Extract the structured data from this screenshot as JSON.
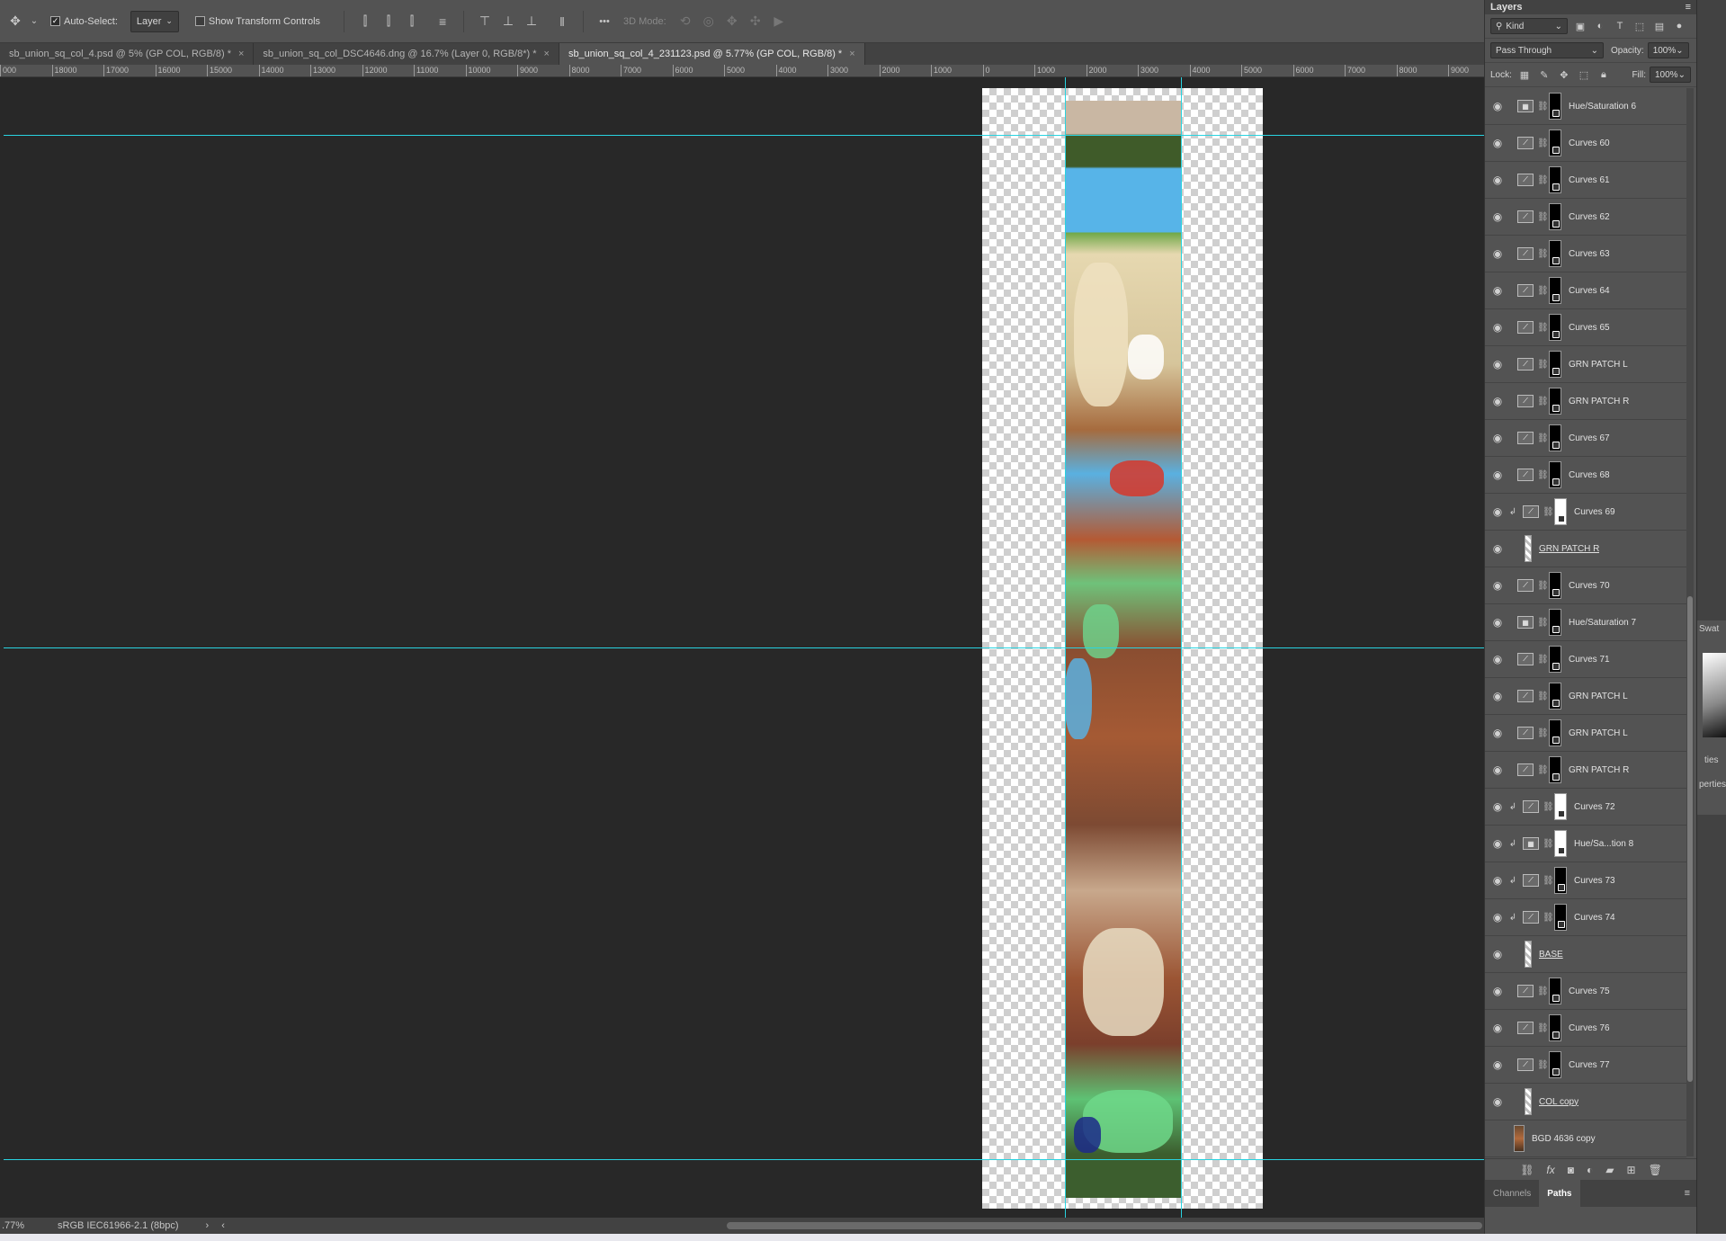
{
  "options_bar": {
    "auto_select_label": "Auto-Select:",
    "layer_select_value": "Layer",
    "show_transform_label": "Show Transform Controls",
    "more_label": "•••",
    "mode_3d_label": "3D Mode:"
  },
  "tabs": [
    {
      "label": "sb_union_sq_col_4.psd @ 5% (GP COL, RGB/8) *",
      "close": "×"
    },
    {
      "label": "sb_union_sq_col_DSC4646.dng @ 16.7% (Layer 0, RGB/8*) *",
      "close": "×"
    },
    {
      "label": "sb_union_sq_col_4_231123.psd @ 5.77% (GP COL, RGB/8) *",
      "close": "×"
    }
  ],
  "ruler_labels": [
    "000",
    "18000",
    "17000",
    "16000",
    "15000",
    "14000",
    "13000",
    "12000",
    "11000",
    "10000",
    "9000",
    "8000",
    "7000",
    "6000",
    "5000",
    "4000",
    "3000",
    "2000",
    "1000",
    "0",
    "1000",
    "2000",
    "3000",
    "4000",
    "5000",
    "6000",
    "7000",
    "8000",
    "9000"
  ],
  "status": {
    "zoom": ".77%",
    "profile": "sRGB IEC61966-2.1 (8bpc)",
    "arrow": "›",
    "back_arrow": "‹"
  },
  "layers_panel": {
    "title": "Layers",
    "kind_label": "Kind",
    "blend_mode": "Pass Through",
    "opacity_label": "Opacity:",
    "opacity_value": "100%",
    "lock_label": "Lock:",
    "fill_label": "Fill:",
    "fill_value": "100%",
    "layers": [
      {
        "name": "Hue/Saturation 6",
        "kind": "huesat",
        "mask": "black",
        "clipped": false,
        "visible": true
      },
      {
        "name": "Curves 60",
        "kind": "curves",
        "mask": "black",
        "clipped": false,
        "visible": true
      },
      {
        "name": "Curves 61",
        "kind": "curves",
        "mask": "black",
        "clipped": false,
        "visible": true
      },
      {
        "name": "Curves 62",
        "kind": "curves",
        "mask": "black",
        "clipped": false,
        "visible": true
      },
      {
        "name": "Curves 63",
        "kind": "curves",
        "mask": "black",
        "clipped": false,
        "visible": true
      },
      {
        "name": "Curves 64",
        "kind": "curves",
        "mask": "black",
        "clipped": false,
        "visible": true
      },
      {
        "name": "Curves 65",
        "kind": "curves",
        "mask": "black",
        "clipped": false,
        "visible": true
      },
      {
        "name": "GRN PATCH L",
        "kind": "curves",
        "mask": "black",
        "clipped": false,
        "visible": true
      },
      {
        "name": "GRN PATCH R",
        "kind": "curves",
        "mask": "black",
        "clipped": false,
        "visible": true
      },
      {
        "name": "Curves 67",
        "kind": "curves",
        "mask": "black",
        "clipped": false,
        "visible": true
      },
      {
        "name": "Curves 68",
        "kind": "curves",
        "mask": "black",
        "clipped": false,
        "visible": true
      },
      {
        "name": "Curves 69",
        "kind": "curves",
        "mask": "white",
        "clipped": true,
        "visible": true
      },
      {
        "name": "GRN PATCH R",
        "kind": "group",
        "mask": "none",
        "clipped": false,
        "visible": true
      },
      {
        "name": "Curves 70",
        "kind": "curves",
        "mask": "black",
        "clipped": false,
        "visible": true
      },
      {
        "name": "Hue/Saturation 7",
        "kind": "huesat",
        "mask": "black",
        "clipped": false,
        "visible": true
      },
      {
        "name": "Curves 71",
        "kind": "curves",
        "mask": "black",
        "clipped": false,
        "visible": true
      },
      {
        "name": "GRN PATCH L",
        "kind": "curves",
        "mask": "black",
        "clipped": false,
        "visible": true
      },
      {
        "name": "GRN PATCH L",
        "kind": "curves",
        "mask": "black",
        "clipped": false,
        "visible": true
      },
      {
        "name": "GRN PATCH R",
        "kind": "curves",
        "mask": "black",
        "clipped": false,
        "visible": true
      },
      {
        "name": "Curves 72",
        "kind": "curves",
        "mask": "white",
        "clipped": true,
        "visible": true
      },
      {
        "name": "Hue/Sa...tion 8",
        "kind": "huesat",
        "mask": "white",
        "clipped": true,
        "visible": true
      },
      {
        "name": "Curves 73",
        "kind": "curves",
        "mask": "black",
        "clipped": true,
        "visible": true
      },
      {
        "name": "Curves 74",
        "kind": "curves",
        "mask": "black",
        "clipped": true,
        "visible": true
      },
      {
        "name": "BASE",
        "kind": "group",
        "mask": "none",
        "clipped": false,
        "visible": true
      },
      {
        "name": "Curves 75",
        "kind": "curves",
        "mask": "black",
        "clipped": false,
        "visible": true
      },
      {
        "name": "Curves 76",
        "kind": "curves",
        "mask": "black",
        "clipped": false,
        "visible": true
      },
      {
        "name": "Curves 77",
        "kind": "curves",
        "mask": "black",
        "clipped": false,
        "visible": true
      },
      {
        "name": "COL copy",
        "kind": "group",
        "mask": "none",
        "clipped": false,
        "visible": true
      },
      {
        "name": "BGD 4636 copy",
        "kind": "photo",
        "mask": "none",
        "clipped": false,
        "visible": false
      }
    ]
  },
  "bottom_tabs": {
    "channels": "Channels",
    "paths": "Paths"
  },
  "collapsed_panels": {
    "swatches": "Swat",
    "properties_tab": "ties",
    "properties": "perties"
  },
  "guide_color": "#29d3e0",
  "icons": {
    "move": "move-tool-icon",
    "eye": "eye-icon",
    "chain": "link-icon",
    "curves": "curves-adjustment-icon",
    "huesat": "hue-saturation-icon",
    "menu": "panel-menu-icon",
    "trash": "trash-icon",
    "fx": "fx-icon"
  }
}
